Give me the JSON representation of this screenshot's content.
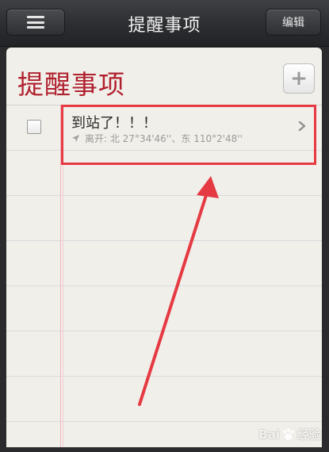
{
  "navbar": {
    "title": "提醒事项",
    "menu_icon": "menu-icon",
    "edit_label": "编辑"
  },
  "list": {
    "title": "提醒事项",
    "add_icon": "plus-icon",
    "add_symbol": "+",
    "items": [
      {
        "title": "到站了！！！",
        "subtitle": "离开: 北 27°34'46''、东 110°2'48''",
        "icon": "location-arrow-icon",
        "checked": false
      }
    ]
  },
  "watermark": {
    "left_text": "Bai",
    "right_text": "经验",
    "icon": "paw-icon"
  },
  "colors": {
    "title_red": "#b0212f",
    "highlight_red": "#e53a43",
    "paper": "#f1efe9",
    "navbar": "#2c2d30"
  }
}
